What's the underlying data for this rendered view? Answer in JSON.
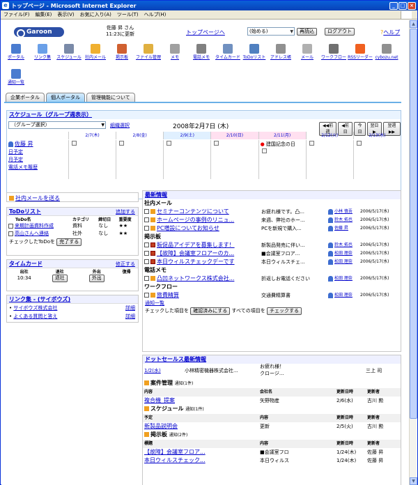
{
  "window": {
    "title": "トップページ - Microsoft Internet Explorer"
  },
  "menu": [
    "ファイル(F)",
    "編集(E)",
    "表示(V)",
    "お気に入り(A)",
    "ツール(T)",
    "ヘルプ(H)"
  ],
  "header": {
    "logo": "Garoon",
    "user_name": "佐藤 昇 さん",
    "updated": "11:23に更新",
    "top_link": "トップページへ",
    "select_value": "(始める)",
    "reload": "再読込",
    "logout": "ログアウト",
    "help": "ヘルプ"
  },
  "apps": [
    {
      "label": "ポータル",
      "color": "#4a7cd0"
    },
    {
      "label": "リンク集",
      "color": "#6aa0e8"
    },
    {
      "label": "スケジュール",
      "color": "#7a8aa8"
    },
    {
      "label": "社内メール",
      "color": "#f0b030"
    },
    {
      "label": "掲示板",
      "color": "#d06030"
    },
    {
      "label": "ファイル管理",
      "color": "#e0b040"
    },
    {
      "label": "メモ",
      "color": "#a0a0a0"
    },
    {
      "label": "電話メモ",
      "color": "#808080"
    },
    {
      "label": "タイムカード",
      "color": "#7090c0"
    },
    {
      "label": "ToDoリスト",
      "color": "#5080c0"
    },
    {
      "label": "アドレス帳",
      "color": "#909090"
    },
    {
      "label": "メール",
      "color": "#b0b0b0"
    },
    {
      "label": "ワークフロー",
      "color": "#707070"
    },
    {
      "label": "RSSリーダー",
      "color": "#f06020"
    },
    {
      "label": "cybozu.net",
      "color": "#909090"
    },
    {
      "label": "通知一覧",
      "color": "#4a7cd0"
    }
  ],
  "tabs": [
    "企業ポータル",
    "個人ポータル",
    "管理機能について"
  ],
  "schedule": {
    "title": "スケジュール（グループ週表示）",
    "group": "（グループ選択）",
    "group_select": "組織選択",
    "date": "2008年2月7日 (木)",
    "nav": [
      "◀◀前週",
      "◀前日",
      "今日",
      "翌日▶",
      "翌週▶▶"
    ],
    "days": [
      "2/7(木)",
      "2/8(金)",
      "2/9(土)",
      "2/10(日)",
      "2/11(月)",
      "2/12(火)",
      "2/13(水)"
    ],
    "holiday": "建国記念の日",
    "user": "佐藤 昇",
    "links": [
      "日予定",
      "月予定",
      "電話メモ履歴"
    ]
  },
  "mail": {
    "link": "社内メールを送る"
  },
  "todo": {
    "title": "ToDoリスト",
    "add": "追加する",
    "headers": [
      "ToDo名",
      "カテゴリ",
      "締切日",
      "重要度"
    ],
    "rows": [
      {
        "name": "来期計画資料作成",
        "cat": "資料",
        "due": "なし",
        "pri": "★★"
      },
      {
        "name": "高山さんへ連絡",
        "cat": "社外",
        "due": "なし",
        "pri": "★★"
      }
    ],
    "checked_label": "チェックしたToDoを",
    "done_btn": "完了する"
  },
  "timecard": {
    "title": "タイムカード",
    "edit": "修正する",
    "headers": [
      "出社",
      "退社",
      "外出",
      "復帰"
    ],
    "in": "10:34",
    "out_btn": "退社",
    "away_btn": "外出"
  },
  "links": {
    "title": "リンク集 - (サイボウズ)",
    "items": [
      "サイボウズ株式会社",
      "よくある質問と答え"
    ],
    "detail": "詳細"
  },
  "news": {
    "title": "最新情報",
    "mail_section": "社内メール",
    "mail": [
      {
        "t": "セミナーコンテンツについて",
        "s": "お疲れ様です。凸...",
        "u": "小林 慎吾",
        "d": "2006/5/17(水)"
      },
      {
        "t": "ホームページの事例のリニュ...",
        "s": "来週、弊社のホー...",
        "u": "鈴木 拓也",
        "d": "2006/5/17(水)"
      },
      {
        "t": "PC増設についてお知らせ",
        "s": "PCを新規で購入...",
        "u": "佐藤 昇",
        "d": "2006/5/17(水)"
      }
    ],
    "board_section": "掲示板",
    "board": [
      {
        "t": "販促品アイデアを募集します！",
        "s": "新製品発売に伴い...",
        "u": "鈴木 拓也",
        "d": "2006/5/17(水)"
      },
      {
        "t": "【故障】会議室フロアーのカ...",
        "s": "■会議室フロア...",
        "u": "松田 理奈",
        "d": "2006/5/17(水)"
      },
      {
        "t": "本日ウィルスチェックデーです",
        "s": "本日ウィルスチェ...",
        "u": "松田 理奈",
        "d": "2006/5/17(水)"
      }
    ],
    "phone_section": "電話メモ",
    "phone": [
      {
        "t": "凸凹ネットワークス株式会社...",
        "s": "折返しお電話ください",
        "u": "松田 理奈",
        "d": "2006/5/17(水)"
      }
    ],
    "wf_section": "ワークフロー",
    "wf": [
      {
        "t": "旅費精算",
        "s": "交通費精算書",
        "u": "松田 理奈",
        "d": "2006/5/17(水)"
      }
    ],
    "notice_list": "通知一覧",
    "checked": "チェックした項目を",
    "confirm_btn": "確認済みにする",
    "all": "すべての項目を",
    "check_btn": "チェックする"
  },
  "dots": {
    "title": "ドットセールス最新情報",
    "top": {
      "date": "1/2(水)",
      "co": "小林精密機器株式会社...",
      "msg1": "お疲れ様！",
      "msg2": "クロージ...",
      "user": "三上 司"
    },
    "case": {
      "label": "案件管理",
      "count": "通知(1件)",
      "headers": [
        "内容",
        "会社名",
        "更新日時",
        "更新者"
      ],
      "rows": [
        {
          "a": "複合機_提案",
          "b": "矢野物産",
          "c": "2/6(水)",
          "d": "古川 勲"
        }
      ]
    },
    "sched": {
      "label": "スケジュール",
      "count": "通知(1件)",
      "headers": [
        "予定",
        "内容",
        "更新日時",
        "更新者"
      ],
      "rows": [
        {
          "a": "新製品説明会",
          "b": "更新",
          "c": "2/5(火)",
          "d": "古川 勲"
        }
      ]
    },
    "board": {
      "label": "掲示板",
      "count": "通知(2件)",
      "headers": [
        "標題",
        "内容",
        "更新日時",
        "更新者"
      ],
      "rows": [
        {
          "a": "【故障】会議室フロア...",
          "b": "■会議室フロ",
          "c": "1/24(木)",
          "d": "佐藤 昇"
        },
        {
          "a": "本日ウィルスチェック...",
          "b": "本日ウィルス",
          "c": "1/24(木)",
          "d": "佐藤 昇"
        }
      ]
    }
  }
}
